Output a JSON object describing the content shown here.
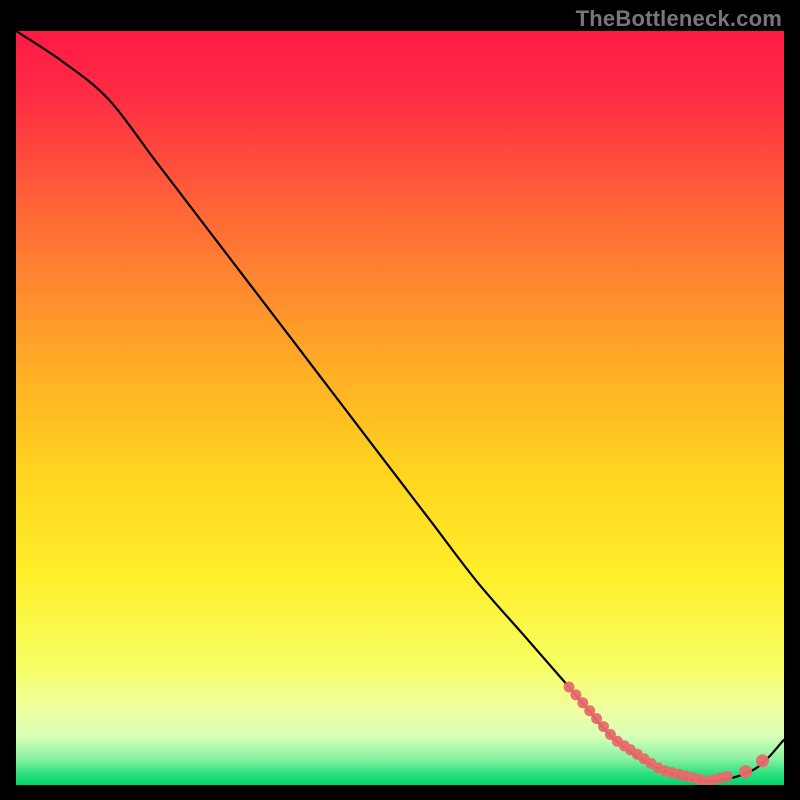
{
  "watermark": "TheBottleneck.com",
  "chart_data": {
    "type": "line",
    "title": "",
    "xlabel": "",
    "ylabel": "",
    "xlim": [
      0,
      100
    ],
    "ylim": [
      0,
      100
    ],
    "grid": false,
    "background_gradient": {
      "top": "#ff1a44",
      "mid_upper": "#ff8a2a",
      "mid": "#ffe02a",
      "mid_lower": "#f9ff7a",
      "bottom": "#00e06a"
    },
    "series": [
      {
        "name": "bottleneck-curve",
        "color": "#000000",
        "x": [
          0,
          6,
          12,
          18,
          24,
          30,
          36,
          42,
          48,
          54,
          60,
          66,
          72,
          78,
          84,
          90,
          96,
          100
        ],
        "values": [
          100,
          96,
          91,
          83,
          75,
          67,
          59,
          51,
          43,
          35,
          27,
          20,
          13,
          6,
          2,
          0.5,
          2,
          6
        ]
      }
    ],
    "highlight_points": {
      "color": "#e86a6a",
      "segments": [
        {
          "x_start": 72,
          "x_end": 80,
          "dense": true,
          "y_approx_start": 12,
          "y_approx_end": 3
        },
        {
          "x_start": 80,
          "x_end": 93,
          "dense": true,
          "y_approx_start": 2,
          "y_approx_end": 0.7
        },
        {
          "x_start": 95,
          "x_end": 98,
          "dense": false,
          "y_approx_start": 2,
          "y_approx_end": 4
        }
      ]
    },
    "description": "A single black curve over a vertical red-yellow-green heat gradient, descending steeply from top-left, reaching a minimum around x≈90, then rising slightly. A cluster of salmon-colored dots marks the low region of the curve (roughly x 72–98)."
  }
}
